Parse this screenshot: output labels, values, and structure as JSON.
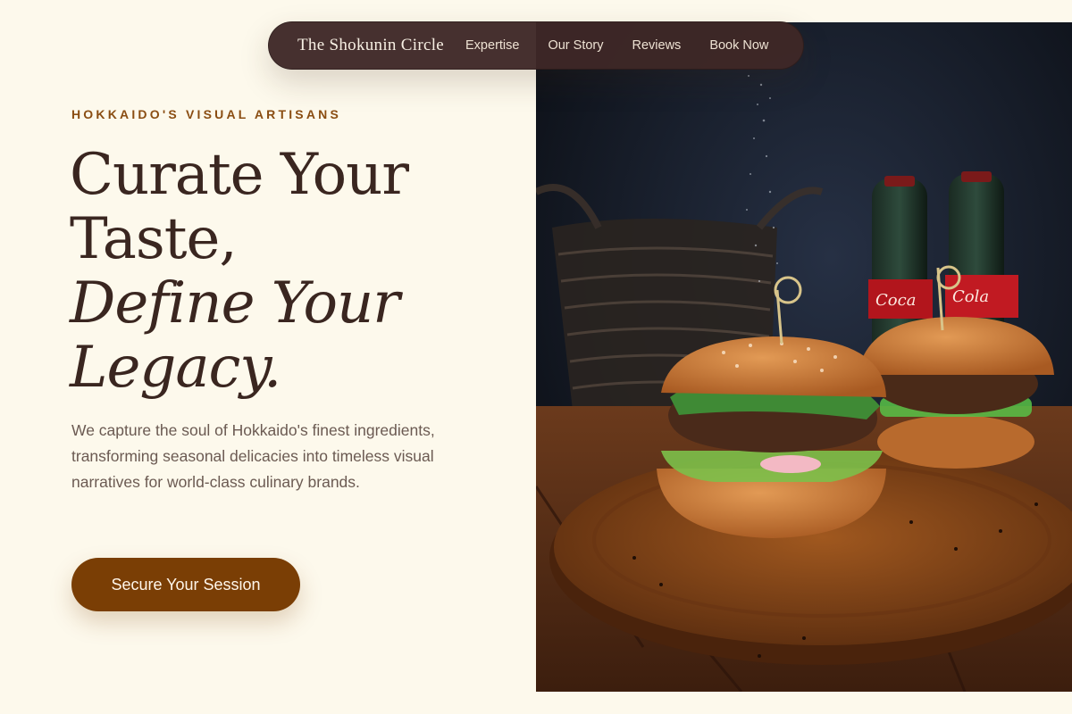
{
  "nav": {
    "brand": "The Shokunin Circle",
    "links": [
      "Expertise",
      "Our Story",
      "Reviews",
      "Book Now"
    ]
  },
  "hero": {
    "eyebrow": "HOKKAIDO'S VISUAL ARTISANS",
    "headline_line1": "Curate Your",
    "headline_line2": "Taste,",
    "headline_line3": "Define Your",
    "headline_line4": "Legacy.",
    "lede": "We capture the soul of Hokkaido's finest ingredients, transforming seasonal delicacies into timeless visual narratives for world-class culinary brands.",
    "cta_label": "Secure Your Session"
  },
  "colors": {
    "page_background": "#fdf9ec",
    "nav_background": "#3e2826",
    "accent": "#7a3e05",
    "eyebrow": "#8a4d12",
    "headline": "#3a2620",
    "body_text": "#6b5a52"
  }
}
